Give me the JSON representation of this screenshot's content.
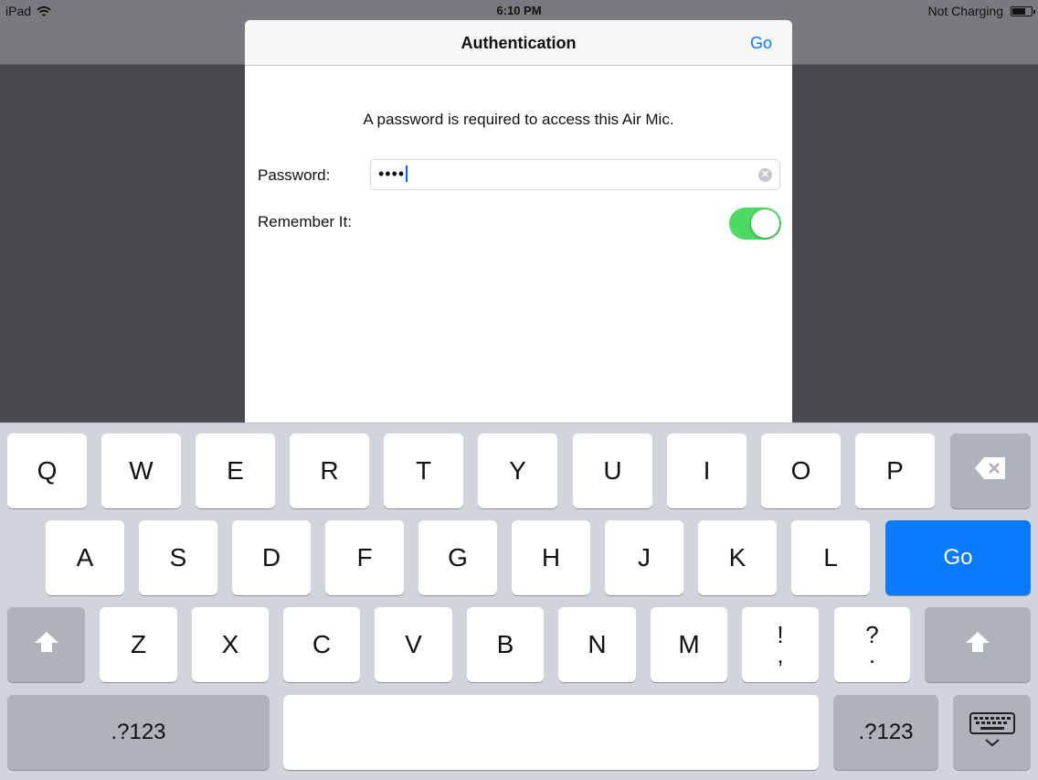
{
  "status_bar": {
    "device": "iPad",
    "time": "6:10 PM",
    "charging": "Not Charging"
  },
  "dialog": {
    "title": "Authentication",
    "go_label": "Go",
    "message": "A password is required to access this Air Mic.",
    "password_label": "Password:",
    "password_value": "••••",
    "remember_label": "Remember It:",
    "remember_on": true
  },
  "keyboard": {
    "row1": [
      "Q",
      "W",
      "E",
      "R",
      "T",
      "Y",
      "U",
      "I",
      "O",
      "P"
    ],
    "row2": [
      "A",
      "S",
      "D",
      "F",
      "G",
      "H",
      "J",
      "K",
      "L"
    ],
    "row3": [
      "Z",
      "X",
      "C",
      "V",
      "B",
      "N",
      "M"
    ],
    "punct1": [
      "!",
      ","
    ],
    "punct2": [
      "?",
      "."
    ],
    "go_label": "Go",
    "numbers_label": ".?123",
    "icons": {
      "delete": "backspace-icon",
      "shift": "shift-icon",
      "dismiss": "keyboard-dismiss-icon"
    }
  },
  "colors": {
    "accent": "#0a7aff",
    "toggle_on": "#4cd964"
  }
}
